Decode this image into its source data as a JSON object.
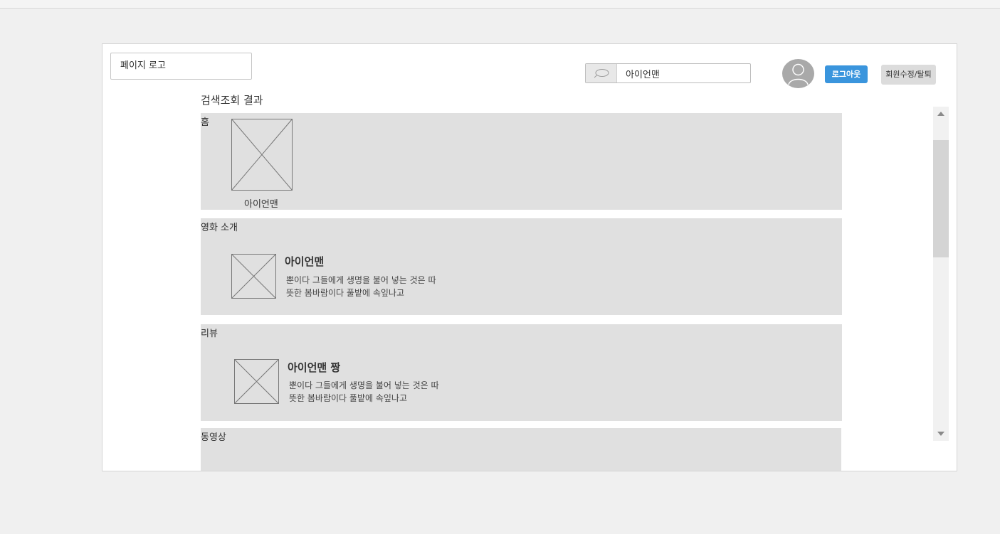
{
  "header": {
    "logo_text": "페이지 로고",
    "search_value": "아이언맨",
    "logout_label": "로그아웃",
    "member_label": "회원수정/탈퇴"
  },
  "results": {
    "title": "검색조회 결과",
    "sections": [
      {
        "label": "홈",
        "items": [
          {
            "caption": "아이언맨",
            "image": "image-placeholder-icon"
          }
        ]
      },
      {
        "label": "영화 소개",
        "items": [
          {
            "title": "아이언맨",
            "desc_line1": "뿐이다 그들에게 생명을 불어 넣는 것은 따",
            "desc_line2": "뜻한 봄바람이다 풀밭에 속잎나고",
            "image": "image-placeholder-icon"
          }
        ]
      },
      {
        "label": "리뷰",
        "items": [
          {
            "title": "아이언맨 짱",
            "desc_line1": "뿐이다 그들에게 생명을 불어 넣는 것은 따",
            "desc_line2": "뜻한 봄바람이다 풀밭에 속잎나고",
            "image": "image-placeholder-icon"
          }
        ]
      },
      {
        "label": "동영상",
        "items": []
      }
    ]
  },
  "icons": {
    "search": "search-icon",
    "avatar": "user-avatar-icon",
    "scroll_up": "arrow-up-icon",
    "scroll_down": "arrow-down-icon"
  },
  "colors": {
    "background": "#f0f0f0",
    "page": "#ffffff",
    "section_bg": "#e0e0e0",
    "accent": "#3a95dd",
    "button_gray": "#dcdcdc",
    "avatar_gray": "#a9a9a9"
  }
}
